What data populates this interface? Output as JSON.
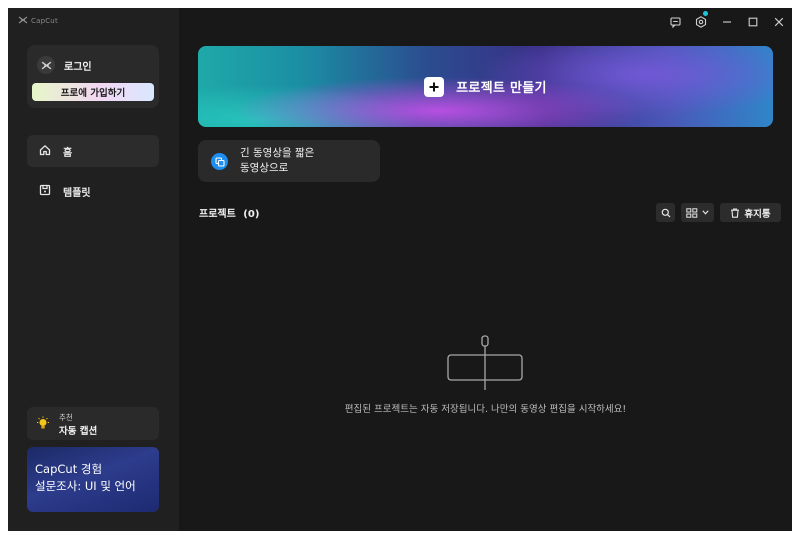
{
  "app": {
    "title": "CapCut"
  },
  "colors": {
    "accent": "#1fc6d8",
    "feature_icon": "#1e8ef0"
  },
  "sidebar": {
    "login_label": "로그인",
    "pro_button": "프로에 가입하기",
    "nav": [
      {
        "label": "홈",
        "icon": "home-icon"
      },
      {
        "label": "템플릿",
        "icon": "template-icon"
      }
    ],
    "promo_small": "추천",
    "promo_big": "자동 캡션",
    "survey_line1": "CapCut 경험",
    "survey_line2": "설문조사: UI 및 언어"
  },
  "main": {
    "create_label": "프로젝트 만들기",
    "feature_line1": "긴 동영상을 짧은",
    "feature_line2": "동영상으로",
    "projects_title": "프로젝트",
    "projects_count": "(0)",
    "trash_label": "휴지통",
    "empty_message": "편집된 프로젝트는 자동 저장됩니다. 나만의 동영상 편집을 시작하세요!"
  }
}
